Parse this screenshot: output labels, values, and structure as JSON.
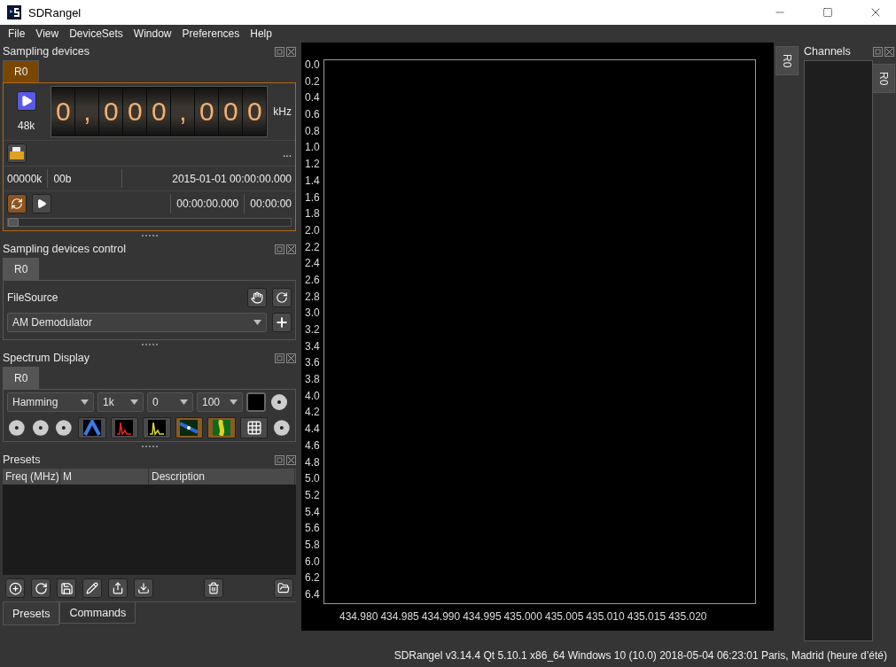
{
  "window": {
    "title": "SDRangel"
  },
  "menu": [
    {
      "label": "File"
    },
    {
      "label": "View"
    },
    {
      "label": "DeviceSets"
    },
    {
      "label": "Window"
    },
    {
      "label": "Preferences"
    },
    {
      "label": "Help"
    }
  ],
  "sampling_devices": {
    "title": "Sampling devices",
    "tabs": [
      {
        "label": "R0",
        "selected": true,
        "highlighted": true
      }
    ],
    "running": false,
    "sample_rate": "48k",
    "digits": [
      "0",
      ",",
      "0",
      "0",
      "0",
      ",",
      "0",
      "0",
      "0"
    ],
    "unit": "kHz",
    "more": "...",
    "file_rate": "00000k",
    "file_bits": "00b",
    "start_time": "2015-01-01 00:00:00.000",
    "loop": true,
    "elapsed": "00:00:00.000",
    "duration": "00:00:00",
    "level": 0
  },
  "device_control": {
    "title": "Sampling devices control",
    "tabs": [
      {
        "label": "R0",
        "selected": true,
        "highlighted": false
      }
    ],
    "device": "FileSource",
    "channel": "AM Demodulator"
  },
  "spectrum": {
    "title": "Spectrum Display",
    "tabs": [
      {
        "label": "R0",
        "selected": true,
        "highlighted": false
      }
    ],
    "window_fn": "Hamming",
    "fft_size": "1k",
    "overlap": "0",
    "averaging": "100",
    "modes": [
      {
        "kind": "spectrum",
        "on": false
      },
      {
        "kind": "maxhold",
        "on": false
      },
      {
        "kind": "current",
        "on": false
      },
      {
        "kind": "waterfall",
        "on": true
      },
      {
        "kind": "histogram",
        "on": true
      },
      {
        "kind": "grid",
        "on": false
      }
    ]
  },
  "presets": {
    "title": "Presets",
    "columns": [
      "Freq (MHz)",
      "M",
      "Description"
    ],
    "tabs": [
      {
        "label": "Presets",
        "selected": true
      },
      {
        "label": "Commands",
        "selected": false
      }
    ]
  },
  "display": {
    "side_tab": "R0",
    "time_labels": [
      "0.0",
      "0.2",
      "0.4",
      "0.6",
      "0.8",
      "1.0",
      "1.2",
      "1.4",
      "1.6",
      "1.8",
      "2.0",
      "2.2",
      "2.4",
      "2.6",
      "2.8",
      "3.0",
      "3.2",
      "3.4",
      "3.6",
      "3.8",
      "4.0",
      "4.2",
      "4.4",
      "4.6",
      "4.8",
      "5.0",
      "5.2",
      "5.4",
      "5.6",
      "5.8",
      "6.0",
      "6.2",
      "6.4"
    ],
    "freq_labels": [
      "434.980",
      "434.985",
      "434.990",
      "434.995",
      "435.000",
      "435.005",
      "435.010",
      "435.015",
      "435.020"
    ]
  },
  "channels": {
    "title": "Channels",
    "tabs": [
      {
        "label": "R0",
        "selected": true
      }
    ]
  },
  "status_bar": "SDRangel v3.14.4 Qt 5.10.1 x86_64 Windows 10 (10.0) 2018-05-04 06:23:01 Paris, Madrid (heure d’été)"
}
